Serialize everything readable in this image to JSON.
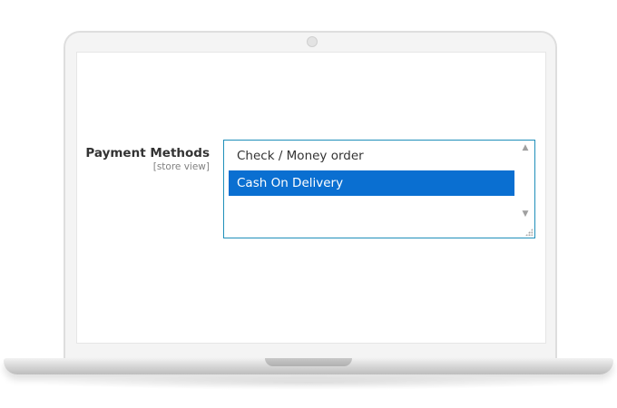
{
  "device": {
    "frame_color": "#f4f4f4",
    "screen_bg": "#ffffff"
  },
  "field": {
    "label": "Payment Methods",
    "scope": "[store view]"
  },
  "multiselect": {
    "border_color": "#1f8fba",
    "selected_color": "#0a6fd1",
    "options": [
      {
        "label": "Check / Money order",
        "selected": false
      },
      {
        "label": "Cash On Delivery",
        "selected": true
      }
    ],
    "scroll_up_icon": "chevron-up-icon",
    "scroll_down_icon": "chevron-down-icon"
  }
}
